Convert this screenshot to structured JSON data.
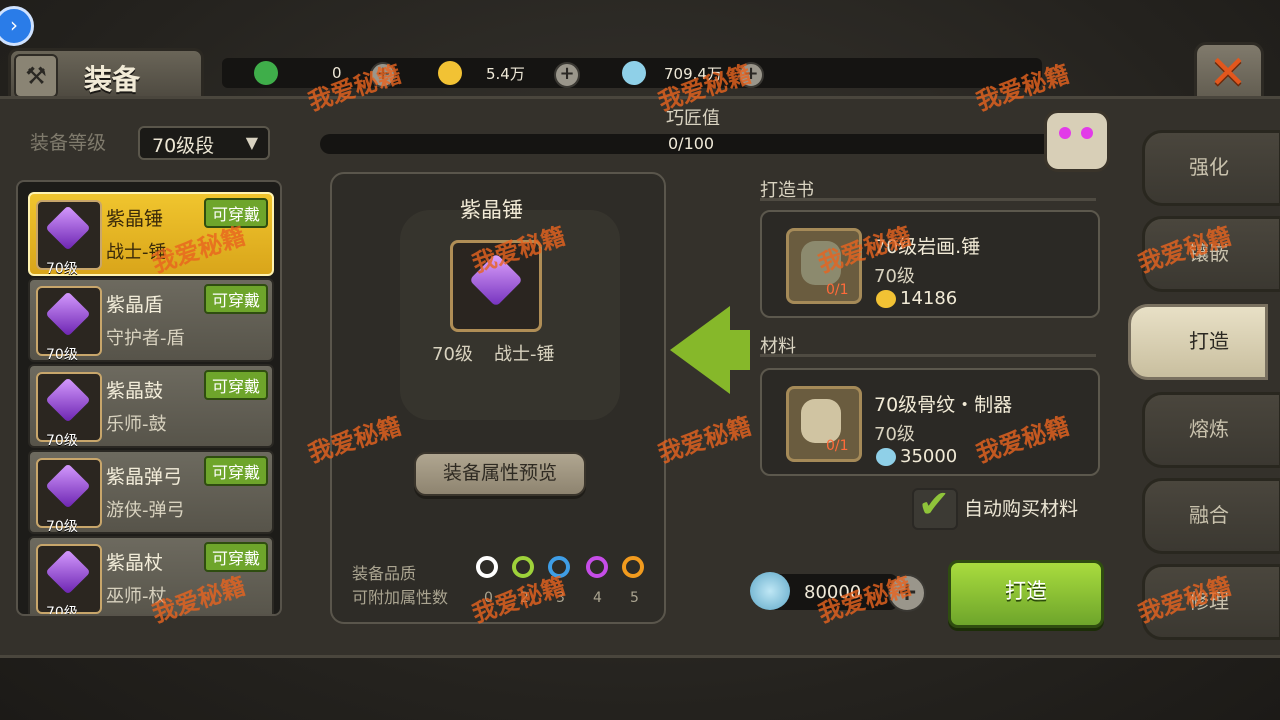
{
  "header": {
    "title": "装备",
    "currencies": [
      {
        "icon": "gem-green-icon",
        "value": "0",
        "color": "#3fae4a"
      },
      {
        "icon": "gold-coin-icon",
        "value": "5.4万",
        "color": "#f2c234"
      },
      {
        "icon": "shell-icon",
        "value": "709.4万",
        "color": "#8fd0e8"
      }
    ]
  },
  "filter": {
    "label": "装备等级",
    "selected": "70级段"
  },
  "equipment_list": [
    {
      "name": "紫晶锤",
      "class": "战士-锤",
      "level": "70级",
      "badge": "可穿戴",
      "selected": true
    },
    {
      "name": "紫晶盾",
      "class": "守护者-盾",
      "level": "70级",
      "badge": "可穿戴",
      "selected": false
    },
    {
      "name": "紫晶鼓",
      "class": "乐师-鼓",
      "level": "70级",
      "badge": "可穿戴",
      "selected": false
    },
    {
      "name": "紫晶弹弓",
      "class": "游侠-弹弓",
      "level": "70级",
      "badge": "可穿戴",
      "selected": false
    },
    {
      "name": "紫晶杖",
      "class": "巫师-杖",
      "level": "70级",
      "badge": "可穿戴",
      "selected": false
    }
  ],
  "craft": {
    "progress_label": "巧匠值",
    "progress_text": "0/100",
    "progress_fraction": 0,
    "item_name": "紫晶锤",
    "item_level": "70级",
    "item_class": "战士-锤",
    "preview_button": "装备属性预览",
    "quality_label": "装备品质",
    "attr_label": "可附加属性数",
    "quality_levels": [
      {
        "num": "0",
        "color": "#ffffff"
      },
      {
        "num": "2",
        "color": "#9ed23a"
      },
      {
        "num": "3",
        "color": "#3f9ee6"
      },
      {
        "num": "4",
        "color": "#c64de8"
      },
      {
        "num": "5",
        "color": "#f29b1e"
      }
    ]
  },
  "book_section": {
    "label": "打造书",
    "title": "70级岩画.锤",
    "level": "70级",
    "count": "0/1",
    "price": "14186"
  },
  "material_section": {
    "label": "材料",
    "title": "70级骨纹・制器",
    "level": "70级",
    "count": "0/1",
    "price": "35000"
  },
  "auto_buy_label": "自动购买材料",
  "cost": "80000",
  "forge_button": "打造",
  "tabs": [
    {
      "label": "强化",
      "active": false
    },
    {
      "label": "镶嵌",
      "active": false
    },
    {
      "label": "打造",
      "active": true
    },
    {
      "label": "熔炼",
      "active": false
    },
    {
      "label": "融合",
      "active": false
    },
    {
      "label": "修理",
      "active": false
    }
  ],
  "watermark": "我爱秘籍"
}
